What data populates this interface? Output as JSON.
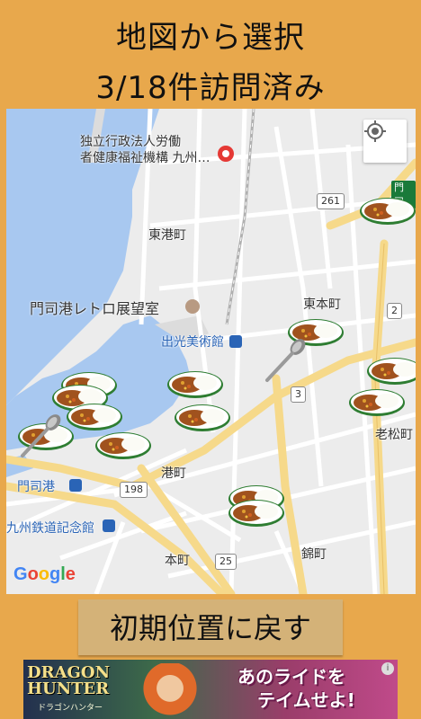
{
  "header": {
    "title": "地図から選択",
    "progress": "3/18件訪問済み"
  },
  "map": {
    "labels": {
      "facility": "独立行政法人労働\n者健康福祉機構 九州…",
      "higashiminato": "東港町",
      "retro_tower": "門司港レトロ展望室",
      "idemitsu": "出光美術館",
      "higashihonmachi": "東本町",
      "oimatsu": "老松町",
      "mojiko": "門司港",
      "railway_museum": "九州鉄道記念館",
      "minatomachi": "港町",
      "honmachi": "本町",
      "nishikimachi": "錦町",
      "moji_edge": "門司"
    },
    "shields": {
      "r261": "261",
      "r2": "2",
      "r3": "3",
      "r198": "198",
      "r25": "25"
    },
    "google_logo": "Google",
    "marker_icon": "curry-rice-icon",
    "visited_icon": "spoon-icon",
    "locate_icon": "my-location-icon"
  },
  "reset_button": {
    "label": "初期位置に戻す"
  },
  "ad": {
    "logo": "DRAGON\nHUNTER",
    "logo_sub": "ドラゴンハンター",
    "text1": "あのライドを",
    "text2": "テイムせよ!",
    "info": "i"
  },
  "colors": {
    "background": "#e8a84c",
    "button": "#d4b278",
    "water": "#a8c8f0",
    "road_major": "#f6d98a"
  }
}
